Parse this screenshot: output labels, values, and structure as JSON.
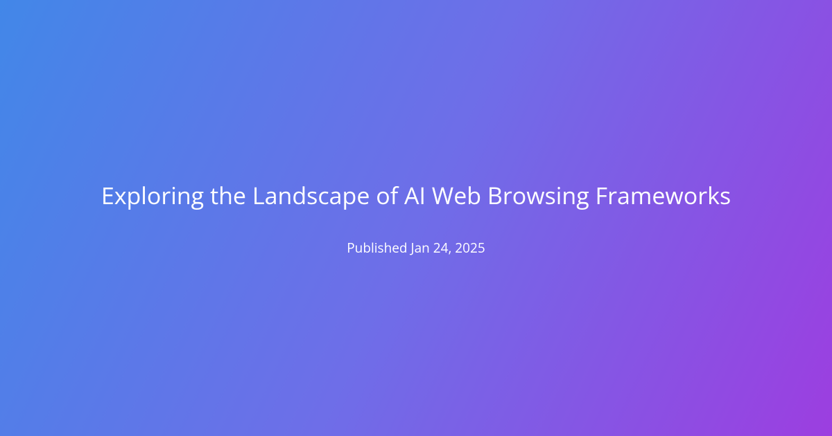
{
  "title": "Exploring the Landscape of AI Web Browsing Frameworks",
  "published": "Published Jan 24, 2025"
}
